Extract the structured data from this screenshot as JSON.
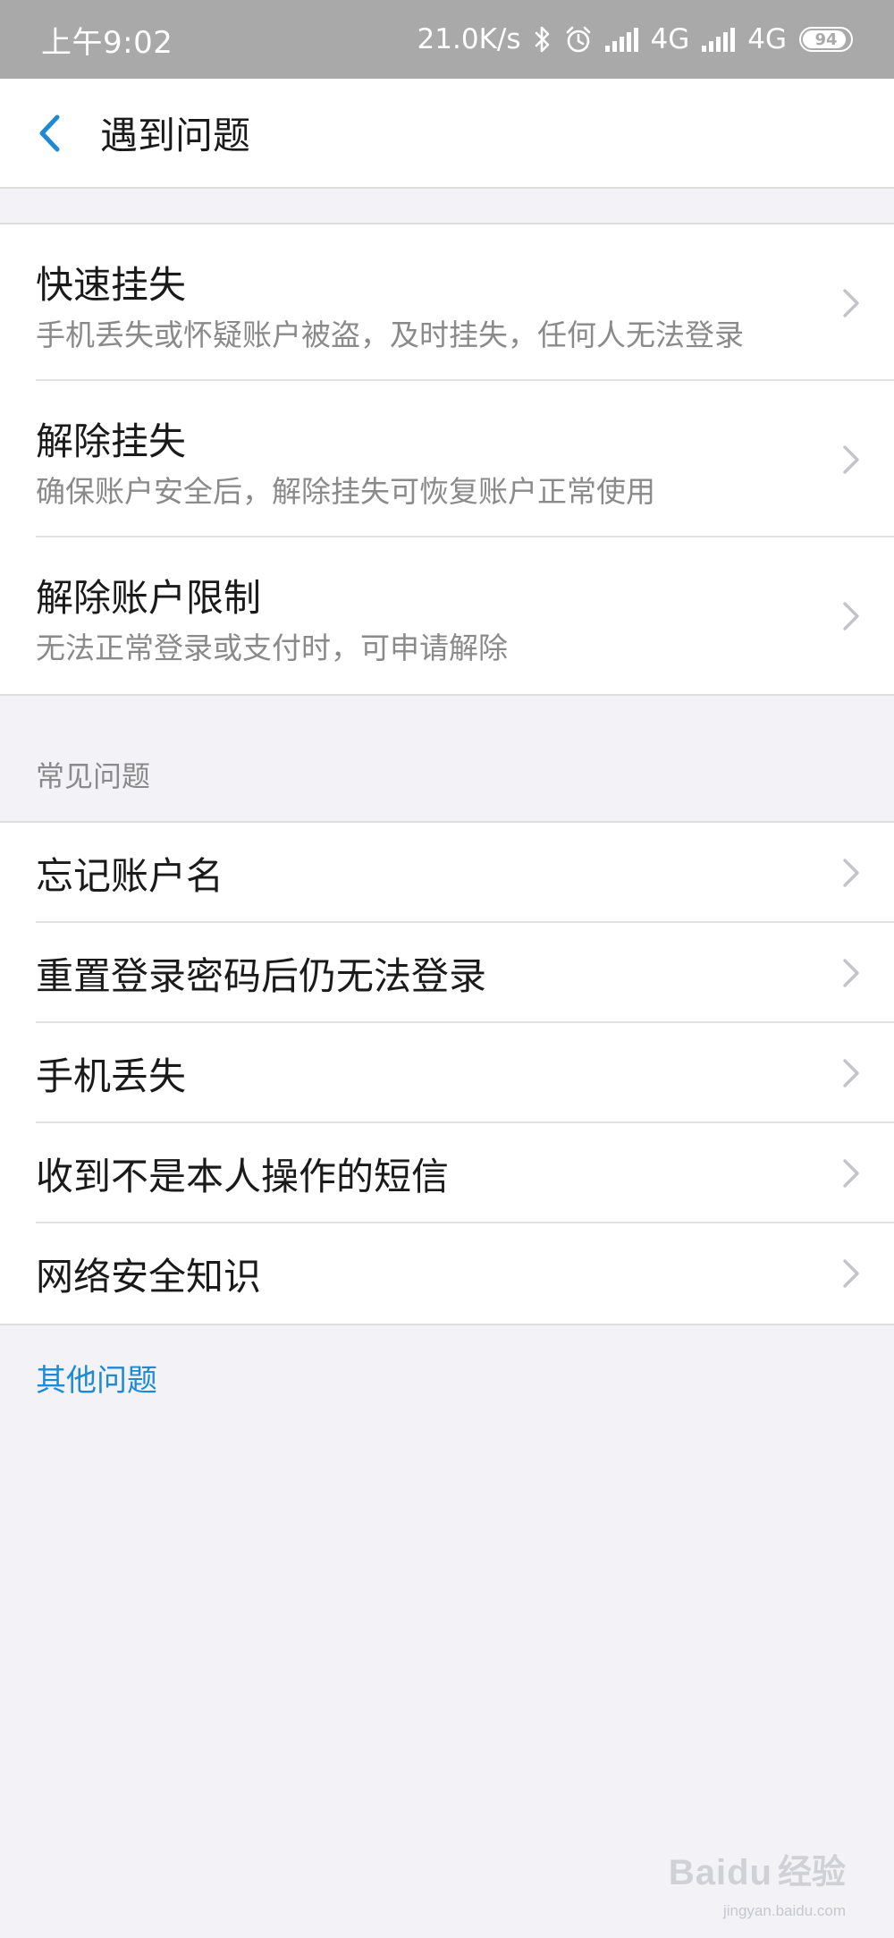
{
  "status_bar": {
    "time": "上午9:02",
    "network_speed": "21.0K/s",
    "network_1": "4G",
    "network_2": "4G",
    "battery": "94",
    "battery_level_percent": 94,
    "icons": [
      "bluetooth-icon",
      "alarm-icon",
      "signal-icon",
      "signal-icon",
      "battery-icon"
    ]
  },
  "nav": {
    "title": "遇到问题",
    "back_icon": "chevron-left-icon",
    "accent": "#1d8ad6"
  },
  "main_items": [
    {
      "title": "快速挂失",
      "subtitle": "手机丢失或怀疑账户被盗，及时挂失，任何人无法登录"
    },
    {
      "title": "解除挂失",
      "subtitle": "确保账户安全后，解除挂失可恢复账户正常使用"
    },
    {
      "title": "解除账户限制",
      "subtitle": "无法正常登录或支付时，可申请解除"
    }
  ],
  "faq": {
    "header": "常见问题",
    "items": [
      {
        "title": "忘记账户名"
      },
      {
        "title": "重置登录密码后仍无法登录"
      },
      {
        "title": "手机丢失"
      },
      {
        "title": "收到不是本人操作的短信"
      },
      {
        "title": "网络安全知识"
      }
    ]
  },
  "other_link": "其他问题",
  "watermark": {
    "brand": "Baidu",
    "sub": "经验",
    "url": "jingyan.baidu.com"
  },
  "colors": {
    "link": "#1d8ad6",
    "status_bar_bg": "#a9a9a9",
    "page_bg": "#f2f2f7",
    "chevron": "#c4c4c8"
  }
}
